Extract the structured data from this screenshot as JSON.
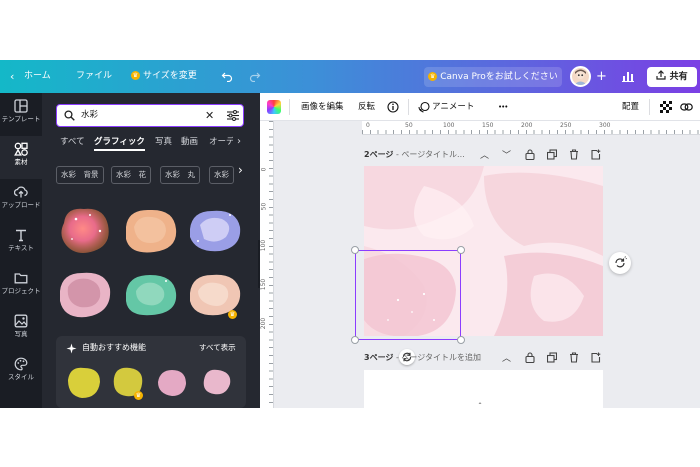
{
  "topbar": {
    "home": "ホーム",
    "file": "ファイル",
    "resize": "サイズを変更",
    "pro_trial": "Canva Proをお試しください",
    "share": "共有"
  },
  "rail": {
    "items": [
      {
        "label": "テンプレート",
        "icon": "template-icon"
      },
      {
        "label": "素材",
        "icon": "elements-icon"
      },
      {
        "label": "アップロード",
        "icon": "upload-icon"
      },
      {
        "label": "テキスト",
        "icon": "text-icon"
      },
      {
        "label": "プロジェクト",
        "icon": "folder-icon"
      },
      {
        "label": "写真",
        "icon": "photo-icon"
      },
      {
        "label": "スタイル",
        "icon": "style-icon"
      }
    ]
  },
  "panel": {
    "search_value": "水彩",
    "tabs": [
      "すべて",
      "グラフィック",
      "写真",
      "動画",
      "オーデ"
    ],
    "chips": [
      "水彩　背景",
      "水彩　花",
      "水彩　丸",
      "水彩　枠"
    ],
    "reco_title": "自動おすすめ機能",
    "reco_all": "すべて表示"
  },
  "toolbar": {
    "edit_image": "画像を編集",
    "flip": "反転",
    "animate": "アニメート",
    "more": "•••",
    "position": "配置"
  },
  "ruler": {
    "h": [
      "0",
      "50",
      "100",
      "150",
      "200",
      "250",
      "300"
    ],
    "v": [
      "0",
      "50",
      "100",
      "150",
      "200"
    ]
  },
  "pages": {
    "p2_label": "2ページ",
    "p2_title": " - ページタイトル...",
    "p3_label": "3ページ",
    "p3_title": " - ページタイトルを追加"
  },
  "colors": {
    "accent": "#8b3dff",
    "panel_bg": "#252830",
    "rail_bg": "#1a1d24"
  }
}
